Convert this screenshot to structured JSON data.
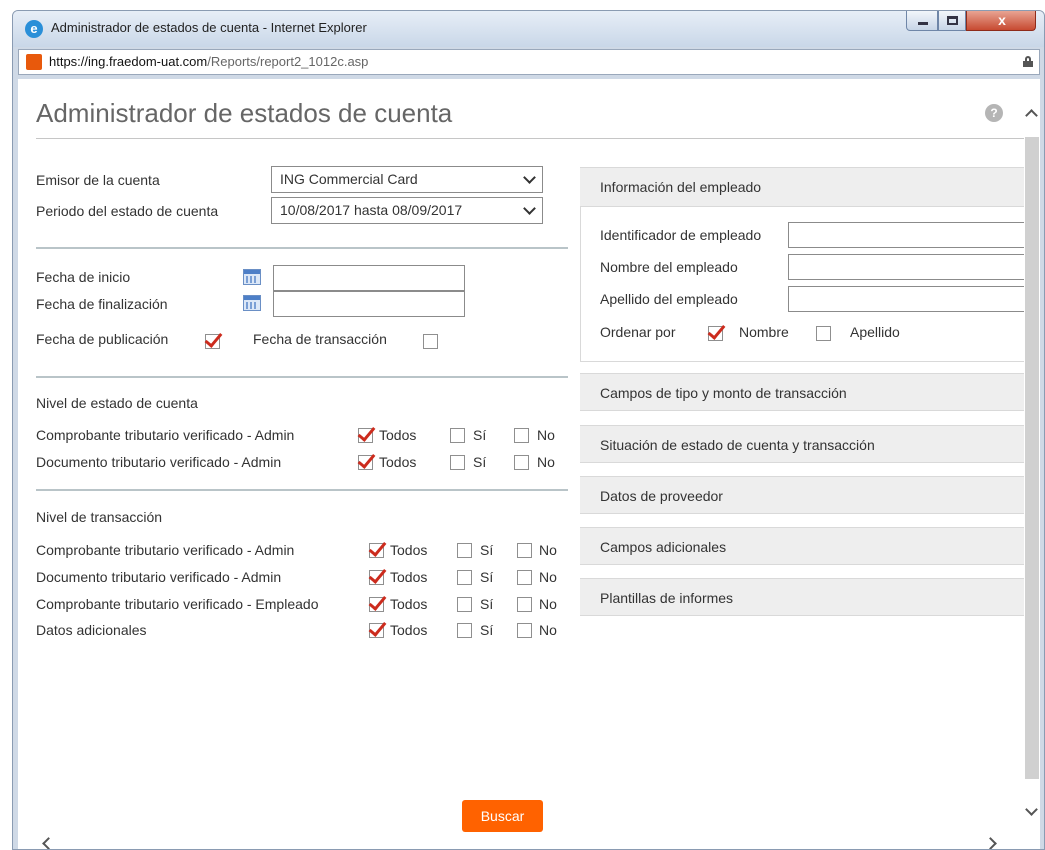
{
  "window": {
    "title": "Administrador de estados de cuenta - Internet Explorer",
    "close_glyph": "x",
    "browser_icon_glyph": "e",
    "url_host": "https://ing.fraedom-uat.com",
    "url_path": "/Reports/report2_1012c.asp"
  },
  "page": {
    "title": "Administrador de estados de cuenta",
    "help_glyph": "?"
  },
  "account": {
    "issuer_label": "Emisor de la cuenta",
    "issuer_value": "ING Commercial Card",
    "period_label": "Periodo del estado de cuenta",
    "period_value": "10/08/2017 hasta 08/09/2017"
  },
  "dates": {
    "start_label": "Fecha de inicio",
    "start_value": "",
    "end_label": "Fecha de finalización",
    "end_value": "",
    "publication_label": "Fecha de publicación",
    "publication_checked": true,
    "transaction_label": "Fecha de transacción",
    "transaction_checked": false
  },
  "statement_level": {
    "title": "Nivel de estado de cuenta",
    "rows": [
      {
        "label": "Comprobante tributario verificado - Admin",
        "todos": "Todos",
        "si": "Sí",
        "no": "No",
        "selected": "todos"
      },
      {
        "label": "Documento tributario verificado - Admin",
        "todos": "Todos",
        "si": "Sí",
        "no": "No",
        "selected": "todos"
      }
    ]
  },
  "transaction_level": {
    "title": "Nivel de transacción",
    "rows": [
      {
        "label": "Comprobante tributario verificado - Admin",
        "todos": "Todos",
        "si": "Sí",
        "no": "No",
        "selected": "todos"
      },
      {
        "label": "Documento tributario verificado - Admin",
        "todos": "Todos",
        "si": "Sí",
        "no": "No",
        "selected": "todos"
      },
      {
        "label": "Comprobante tributario verificado - Empleado",
        "todos": "Todos",
        "si": "Sí",
        "no": "No",
        "selected": "todos"
      },
      {
        "label": "Datos adicionales",
        "todos": "Todos",
        "si": "Sí",
        "no": "No",
        "selected": "todos"
      }
    ]
  },
  "employee": {
    "section_title": "Información del empleado",
    "id_label": "Identificador de empleado",
    "id_value": "",
    "first_name_label": "Nombre del empleado",
    "first_name_value": "",
    "last_name_label": "Apellido del empleado",
    "last_name_value": "",
    "sort_label": "Ordenar por",
    "sort_first_name": "Nombre",
    "sort_last_name": "Apellido",
    "sort_selected": "nombre"
  },
  "sections": [
    {
      "title": "Campos de tipo y monto de transacción"
    },
    {
      "title": "Situación de estado de cuenta y transacción"
    },
    {
      "title": "Datos de proveedor"
    },
    {
      "title": "Campos adicionales"
    },
    {
      "title": "Plantillas de informes"
    }
  ],
  "actions": {
    "search_label": "Buscar"
  },
  "icons": {
    "browser": "internet-explorer-icon",
    "site": "site-favicon-icon",
    "lock": "lock-icon",
    "help": "help-icon",
    "calendar": "calendar-icon",
    "dropdown": "chevron-down-icon"
  },
  "colors": {
    "accent": "#ff6200",
    "check_mark": "#cc2b1d",
    "section_bg": "#eeeeee"
  }
}
